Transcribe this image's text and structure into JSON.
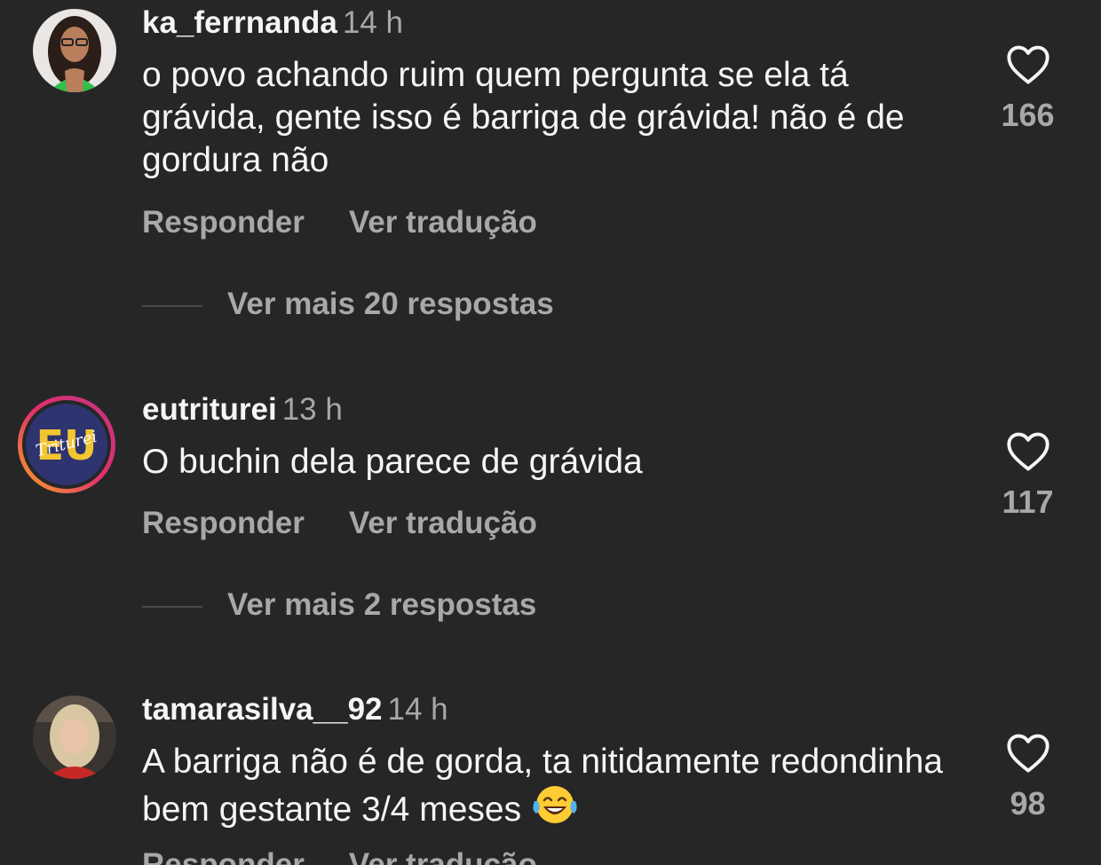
{
  "comments": [
    {
      "username": "ka_ferrnanda",
      "time": "14 h",
      "text": "o povo achando ruim quem pergunta se ela tá grávida, gente isso é barriga de grávida! não é de gordura não",
      "reply_label": "Responder",
      "translate_label": "Ver tradução",
      "more_replies": "Ver mais 20 respostas",
      "likes": "166",
      "avatar_icon": "profile-photo"
    },
    {
      "username": "eutriturei",
      "time": "13 h",
      "text": "O buchin dela parece de grávida",
      "reply_label": "Responder",
      "translate_label": "Ver tradução",
      "more_replies": "Ver mais 2 respostas",
      "likes": "117",
      "avatar_icon": "eu-triturei-logo",
      "avatar_logo_text": "EU",
      "avatar_logo_script": "Triturei"
    },
    {
      "username": "tamarasilva__92",
      "time": "14 h",
      "text": "A barriga não é de gorda, ta nitidamente redondinha bem gestante 3/4 meses",
      "emoji": "laughing-tears-emoji",
      "reply_label": "Responder",
      "translate_label": "Ver tradução",
      "likes": "98",
      "avatar_icon": "profile-photo"
    }
  ],
  "colors": {
    "background": "#262626",
    "primary_text": "#f5f5f5",
    "secondary_text": "#a8a8a8",
    "story_ring": "#e1306c"
  },
  "icons": {
    "like": "heart-outline-icon"
  }
}
